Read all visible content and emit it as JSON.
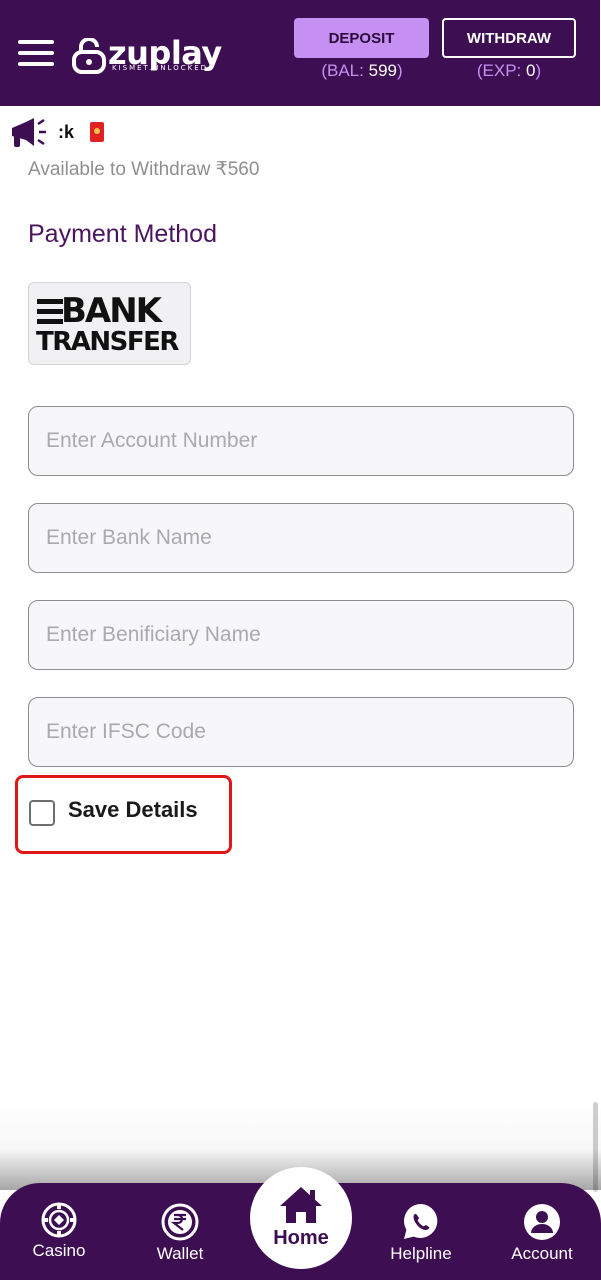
{
  "header": {
    "logo_text": "zuplay",
    "logo_tagline": "KISMET.UNLOCKED",
    "deposit_label": "DEPOSIT",
    "withdraw_label": "WITHDRAW",
    "balance_prefix": "(BAL:",
    "balance_value": "599",
    "balance_suffix": ")",
    "exposure_prefix": "(EXP:",
    "exposure_value": "0",
    "exposure_suffix": ")"
  },
  "announcement": {
    "icon": "megaphone-icon",
    "text": ":k"
  },
  "withdraw": {
    "available_text": "Available to Withdraw ₹560"
  },
  "payment_method": {
    "title": "Payment Method",
    "method_line1": "BANK",
    "method_line2": "TRANSFER"
  },
  "form": {
    "account_number_placeholder": "Enter Account Number",
    "bank_name_placeholder": "Enter Bank Name",
    "beneficiary_name_placeholder": "Enter Benificiary Name",
    "ifsc_placeholder": "Enter IFSC Code",
    "save_details_label": "Save Details",
    "save_details_checked": false
  },
  "bottom_nav": {
    "items": [
      {
        "label": "Casino",
        "icon": "casino-chip-icon"
      },
      {
        "label": "Wallet",
        "icon": "rupee-icon"
      },
      {
        "label": "Home",
        "icon": "home-icon"
      },
      {
        "label": "Helpline",
        "icon": "whatsapp-icon"
      },
      {
        "label": "Account",
        "icon": "user-icon"
      }
    ]
  },
  "colors": {
    "brand_purple": "#3d0f52",
    "accent_lavender": "#c690f2",
    "highlight_red": "#e01717"
  }
}
